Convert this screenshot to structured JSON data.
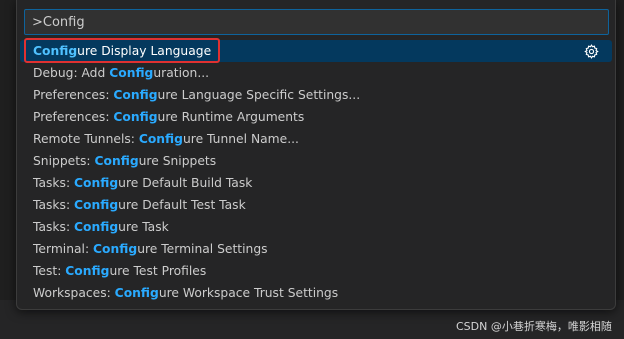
{
  "command_palette": {
    "input_value": ">Config",
    "query_highlight": "Config",
    "items": [
      {
        "prefix": "",
        "match": "Config",
        "suffix": "ure Display Language",
        "selected": true,
        "icon": "gear-icon"
      },
      {
        "prefix": "Debug: Add ",
        "match": "Config",
        "suffix": "uration...",
        "selected": false
      },
      {
        "prefix": "Preferences: ",
        "match": "Config",
        "suffix": "ure Language Specific Settings...",
        "selected": false
      },
      {
        "prefix": "Preferences: ",
        "match": "Config",
        "suffix": "ure Runtime Arguments",
        "selected": false
      },
      {
        "prefix": "Remote Tunnels: ",
        "match": "Config",
        "suffix": "ure Tunnel Name...",
        "selected": false
      },
      {
        "prefix": "Snippets: ",
        "match": "Config",
        "suffix": "ure Snippets",
        "selected": false
      },
      {
        "prefix": "Tasks: ",
        "match": "Config",
        "suffix": "ure Default Build Task",
        "selected": false
      },
      {
        "prefix": "Tasks: ",
        "match": "Config",
        "suffix": "ure Default Test Task",
        "selected": false
      },
      {
        "prefix": "Tasks: ",
        "match": "Config",
        "suffix": "ure Task",
        "selected": false
      },
      {
        "prefix": "Terminal: ",
        "match": "Config",
        "suffix": "ure Terminal Settings",
        "selected": false
      },
      {
        "prefix": "Test: ",
        "match": "Config",
        "suffix": "ure Test Profiles",
        "selected": false
      },
      {
        "prefix": "Workspaces: ",
        "match": "Config",
        "suffix": "ure Workspace Trust Settings",
        "selected": false
      }
    ]
  },
  "watermark": "CSDN @小巷折寒梅，唯影相随",
  "colors": {
    "accent": "#0e639c",
    "selection": "#04395e",
    "match_highlight": "#2aaaff",
    "annotation_box": "#e03131"
  }
}
